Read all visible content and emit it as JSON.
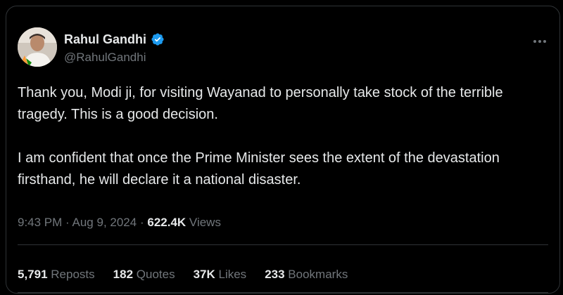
{
  "author": {
    "display_name": "Rahul Gandhi",
    "handle": "@RahulGandhi",
    "verified_color": "#1d9bf0"
  },
  "tweet": {
    "paragraphs": [
      "Thank you, Modi ji, for visiting Wayanad to personally take stock of the terrible tragedy. This is a good decision.",
      "I am confident that once the Prime Minister sees the extent of the devastation firsthand, he will declare it a national disaster."
    ]
  },
  "meta": {
    "time": "9:43 PM",
    "separator": "·",
    "date": "Aug 9, 2024",
    "views_count": "622.4K",
    "views_label": "Views"
  },
  "stats": {
    "reposts_count": "5,791",
    "reposts_label": "Reposts",
    "quotes_count": "182",
    "quotes_label": "Quotes",
    "likes_count": "37K",
    "likes_label": "Likes",
    "bookmarks_count": "233",
    "bookmarks_label": "Bookmarks"
  },
  "icons": {
    "more": "more-options-icon",
    "verified": "verified-badge-icon"
  }
}
